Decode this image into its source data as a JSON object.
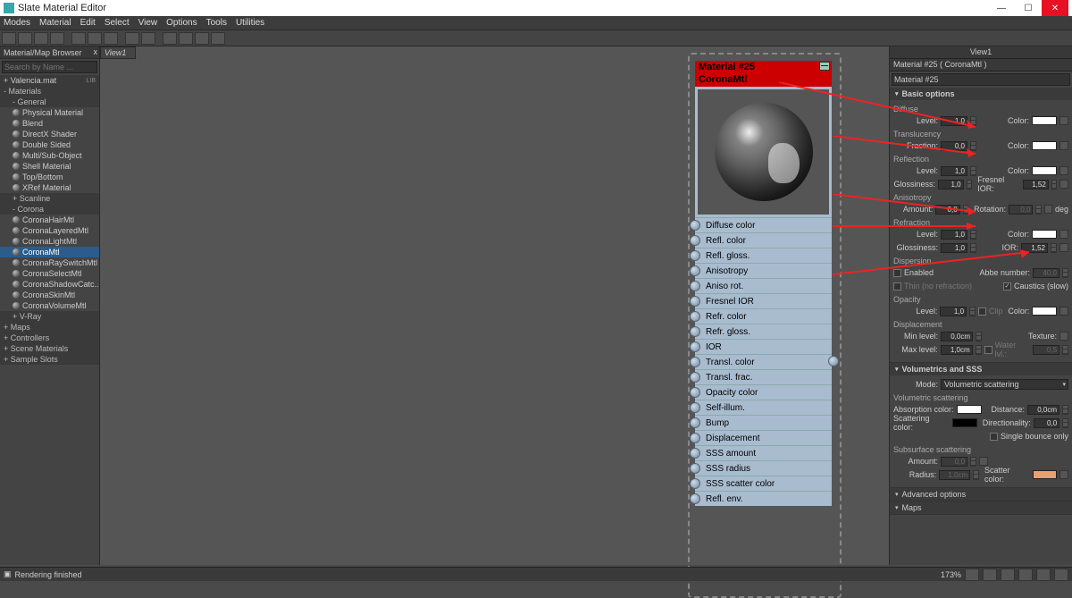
{
  "app": {
    "title": "Slate Material Editor"
  },
  "menu": [
    "Modes",
    "Material",
    "Edit",
    "Select",
    "View",
    "Options",
    "Tools",
    "Utilities"
  ],
  "browser": {
    "title": "Material/Map Browser",
    "search_placeholder": "Search by Name ...",
    "lib": "+ Valencia.mat",
    "lib_tag": "LIB",
    "materials_hdr": "- Materials",
    "general_hdr": "- General",
    "general": [
      "Physical Material",
      "Blend",
      "DirectX Shader",
      "Double Sided",
      "Multi/Sub-Object",
      "Shell Material",
      "Top/Bottom",
      "XRef Material"
    ],
    "scanline_hdr": "+ Scanline",
    "corona_hdr": "- Corona",
    "corona": [
      "CoronaHairMtl",
      "CoronaLayeredMtl",
      "CoronaLightMtl",
      "CoronaMtl",
      "CoronaRaySwitchMtl",
      "CoronaSelectMtl",
      "CoronaShadowCatc...",
      "CoronaSkinMtl",
      "CoronaVolumeMtl"
    ],
    "vray_hdr": "+ V-Ray",
    "maps_hdr": "+ Maps",
    "controllers_hdr": "+ Controllers",
    "scene_hdr": "+ Scene Materials",
    "slots_hdr": "+ Sample Slots"
  },
  "viewport": {
    "tab": "View1"
  },
  "node": {
    "title": "Material #25",
    "subtitle": "CoronaMtl",
    "slots": [
      "Diffuse color",
      "Refl. color",
      "Refl. gloss.",
      "Anisotropy",
      "Aniso rot.",
      "Fresnel IOR",
      "Refr. color",
      "Refr. gloss.",
      "IOR",
      "Transl. color",
      "Transl. frac.",
      "Opacity color",
      "Self-illum.",
      "Bump",
      "Displacement",
      "SSS amount",
      "SSS radius",
      "SSS scatter color",
      "Refl. env."
    ]
  },
  "props": {
    "panel_tab": "View1",
    "panel_title": "Material #25  ( CoronaMtl )",
    "mat_name": "Material #25",
    "basic_hdr": "Basic options",
    "diffuse_lbl": "Diffuse",
    "level_lbl": "Level:",
    "color_lbl": "Color:",
    "diffuse_level": "1,0",
    "transl_lbl": "Translucency",
    "fraction_lbl": "Fraction:",
    "transl_fraction": "0,0",
    "refl_lbl": "Reflection",
    "refl_level": "1,0",
    "gloss_lbl": "Glossiness:",
    "refl_gloss": "1,0",
    "fresnel_lbl": "Fresnel IOR:",
    "fresnel": "1,52",
    "aniso_lbl": "Anisotropy",
    "amount_lbl": "Amount:",
    "aniso_amount": "0,0",
    "rotation_lbl": "Rotation:",
    "aniso_rot": "0,0",
    "deg": "deg",
    "refr_lbl": "Refraction",
    "refr_level": "1,0",
    "refr_gloss": "1,0",
    "ior_lbl": "IOR:",
    "refr_ior": "1,52",
    "disp_lbl": "Dispersion",
    "enabled_lbl": "Enabled",
    "abbe_lbl": "Abbe number:",
    "abbe": "40,0",
    "thin_lbl": "Thin (no refraction)",
    "caustics_lbl": "Caustics (slow)",
    "opacity_lbl": "Opacity",
    "opacity_level": "1,0",
    "clip_lbl": "Clip",
    "displ_lbl": "Displacement",
    "minlvl_lbl": "Min level:",
    "minlvl": "0,0cm",
    "texture_lbl": "Texture:",
    "maxlvl_lbl": "Max level:",
    "maxlvl": "1,0cm",
    "water_lbl": "Water lvl.:",
    "water": "0,5",
    "vol_hdr": "Volumetrics and SSS",
    "mode_lbl": "Mode:",
    "mode_val": "Volumetric scattering",
    "volscat_lbl": "Volumetric scattering",
    "abscol_lbl": "Absorption color:",
    "dist_lbl": "Distance:",
    "dist": "0,0cm",
    "scatcol_lbl": "Scattering color:",
    "dir_lbl": "Directionality:",
    "dir": "0,0",
    "single_lbl": "Single bounce only",
    "sss_lbl": "Subsurface scattering",
    "sss_amount": "0,0",
    "radius_lbl": "Radius:",
    "sss_radius": "1,0cm",
    "scatter_color_lbl": "Scatter color:",
    "adv_hdr": "Advanced options",
    "maps_roll": "Maps"
  },
  "status": {
    "text": "Rendering finished",
    "zoom": "173%"
  }
}
